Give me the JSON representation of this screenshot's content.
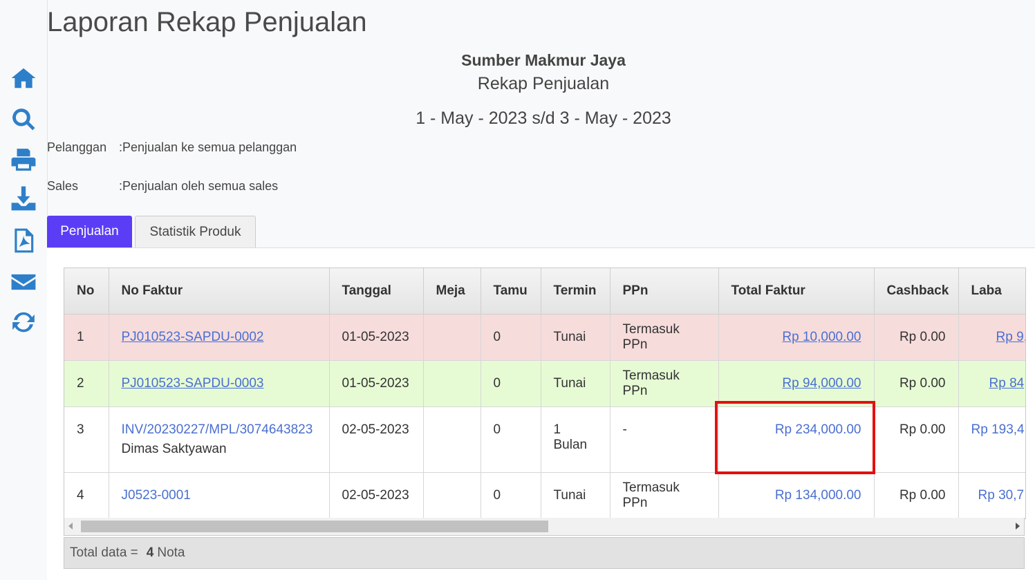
{
  "page_title": "Laporan Rekap Penjualan",
  "company": "Sumber Makmur Jaya",
  "subtitle": "Rekap Penjualan",
  "period": "1 - May - 2023 s/d 3 - May - 2023",
  "info": {
    "pelanggan_label": "Pelanggan",
    "pelanggan_value": ":Penjualan ke semua pelanggan",
    "sales_label": "Sales",
    "sales_value": ":Penjualan oleh semua sales"
  },
  "tabs": [
    "Penjualan",
    "Statistik Produk"
  ],
  "sidebar_icons": [
    "home-icon",
    "search-icon",
    "print-icon",
    "download-icon",
    "pdf-icon",
    "email-icon",
    "refresh-icon"
  ],
  "table": {
    "headers": [
      "No",
      "No Faktur",
      "Tanggal",
      "Meja",
      "Tamu",
      "Termin",
      "PPn",
      "Total Faktur",
      "Cashback",
      "Laba"
    ],
    "rows": [
      {
        "no": "1",
        "faktur": "PJ010523-SAPDU-0002",
        "customer": "",
        "tanggal": "01-05-2023",
        "meja": "",
        "tamu": "0",
        "termin": "Tunai",
        "ppn": "Termasuk PPn",
        "total": "Rp 10,000.00",
        "cashback": "Rp 0.00",
        "laba": "Rp 9,"
      },
      {
        "no": "2",
        "faktur": "PJ010523-SAPDU-0003",
        "customer": "",
        "tanggal": "01-05-2023",
        "meja": "",
        "tamu": "0",
        "termin": "Tunai",
        "ppn": "Termasuk PPn",
        "total": "Rp 94,000.00",
        "cashback": "Rp 0.00",
        "laba": "Rp 84,"
      },
      {
        "no": "3",
        "faktur": "INV/20230227/MPL/3074643823",
        "customer": "Dimas Saktyawan",
        "tanggal": "02-05-2023",
        "meja": "",
        "tamu": "0",
        "termin": "1 Bulan",
        "ppn": "-",
        "total": "Rp 234,000.00",
        "cashback": "Rp 0.00",
        "laba": "Rp 193,4"
      },
      {
        "no": "4",
        "faktur": "J0523-0001",
        "customer": "",
        "tanggal": "02-05-2023",
        "meja": "",
        "tamu": "0",
        "termin": "Tunai",
        "ppn": "Termasuk PPn",
        "total": "Rp 134,000.00",
        "cashback": "Rp 0.00",
        "laba": "Rp 30,7"
      }
    ]
  },
  "footer": {
    "label": "Total data =",
    "count": "4",
    "unit": "Nota"
  },
  "colors": {
    "accent": "#5b3df5",
    "icon": "#2e7fc9",
    "link": "#4a6fd1",
    "highlight": "#e31010",
    "row1": "#f7dcdc",
    "row2": "#e6fbd4"
  }
}
